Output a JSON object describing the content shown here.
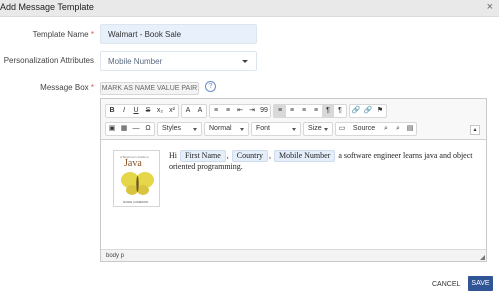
{
  "dialog": {
    "title": "Add Message Template",
    "close_icon": "×"
  },
  "form": {
    "template_name_label": "Template Name",
    "template_name_value": "Walmart - Book Sale",
    "personalization_label": "Personalization Attributes",
    "personalization_value": "Mobile Number",
    "message_box_label": "Message Box",
    "required_marker": "*",
    "mark_button": "MARK AS NAME VALUE PAIR",
    "help_icon": "?"
  },
  "editor": {
    "toolbar_row1": [
      "B",
      "I",
      "U",
      "S",
      "x₂",
      "x²",
      "A",
      "A",
      "≡",
      "≡",
      "⇤",
      "⇥",
      "99",
      "≡",
      "≡",
      "≡",
      "≡",
      "¶",
      "¶",
      "🔗",
      "🔗",
      "⚑"
    ],
    "toolbar_row2": {
      "styles": "Styles",
      "format": "Normal",
      "font": "Font",
      "size": "Size",
      "source": "Source"
    },
    "book": {
      "small_title": "A Beginner's Guide to",
      "title": "Java",
      "author": "DANIE CAMERON"
    },
    "body": {
      "prefix": "Hi",
      "tags": [
        "First Name",
        "Country",
        "Mobile Number"
      ],
      "separator": ",",
      "suffix": "a software engineer learns java and object oriented programming."
    },
    "status": "body  p"
  },
  "footer": {
    "cancel": "CANCEL",
    "save": "SAVE"
  }
}
